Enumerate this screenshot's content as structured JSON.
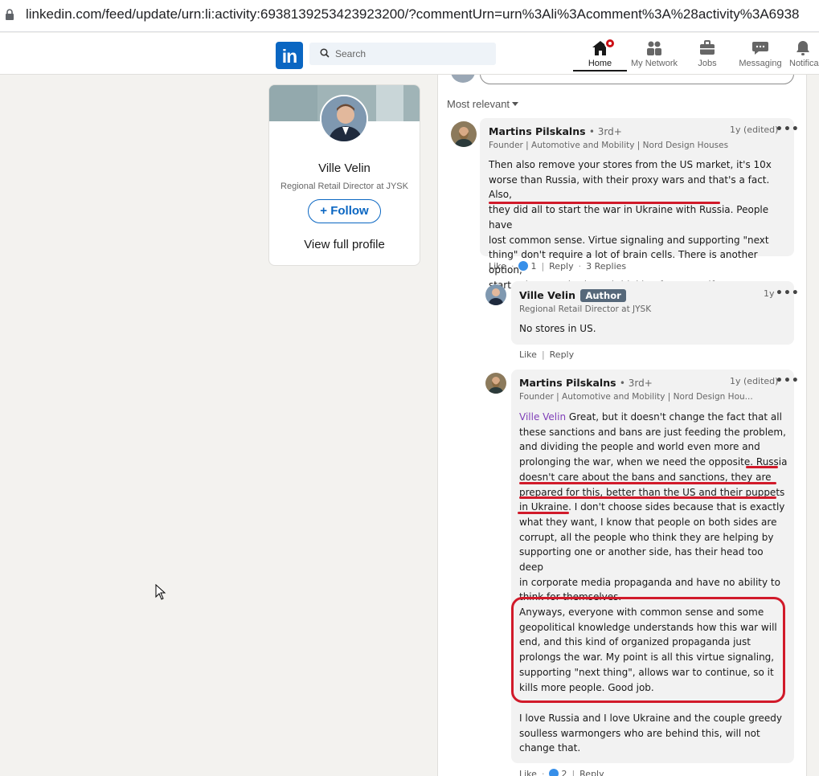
{
  "browser": {
    "url": "linkedin.com/feed/update/urn:li:activity:6938139253423923200/?commentUrn=urn%3Ali%3Acomment%3A%28activity%3A6938"
  },
  "nav": {
    "logo": "in",
    "search_placeholder": "Search",
    "items": [
      {
        "label": "Home",
        "icon": "home-icon"
      },
      {
        "label": "My Network",
        "icon": "network-icon"
      },
      {
        "label": "Jobs",
        "icon": "briefcase-icon"
      },
      {
        "label": "Messaging",
        "icon": "chat-icon"
      },
      {
        "label": "Notifica",
        "icon": "bell-icon"
      }
    ]
  },
  "profile": {
    "name": "Ville Velin",
    "headline": "Regional Retail Director at JYSK",
    "follow_label": "+ Follow",
    "view_profile": "View full profile"
  },
  "comments": {
    "sort_label": "Most relevant",
    "c1": {
      "name": "Martins Pilskalns",
      "degree": "• 3rd+",
      "headline": "Founder | Automotive and Mobility | Nord Design Houses",
      "time": "1y (edited)",
      "more": "•••",
      "lines": [
        "Then also remove your stores from the US market, it's 10x",
        "worse than Russia, with their proxy wars and that's a fact. Also,",
        "they did all to start the war in Ukraine with Russia. People have",
        "lost common sense. Virtue signaling and supporting \"next",
        "thing\" don't require a lot of brain cells. There is another option,",
        "start using your brain and thinking for yourself."
      ],
      "like": "Like",
      "reaction_count": "1",
      "reply": "Reply",
      "replies": "3 Replies"
    },
    "r1": {
      "name": "Ville Velin",
      "badge": "Author",
      "headline": "Regional Retail Director at JYSK",
      "time": "1y",
      "more": "•••",
      "text": "No stores in US.",
      "like": "Like",
      "reply": "Reply"
    },
    "r2": {
      "name": "Martins Pilskalns",
      "degree": "• 3rd+",
      "headline": "Founder | Automotive and Mobility | Nord Design Hou...",
      "time": "1y (edited)",
      "more": "•••",
      "mention": "Ville Velin",
      "lines": [
        " Great, but it doesn't change the fact that all",
        "these sanctions and bans are just feeding the problem,",
        "and dividing the people and world even more and",
        "prolonging the war, when we need the opposite. Russia",
        "doesn't care about the bans and sanctions, they are",
        "prepared for this, better than the US and their puppets",
        "in Ukraine. I don't choose sides because that is exactly",
        "what they want, I know that people on both sides are",
        "corrupt, all the people who think they are helping by",
        "supporting one or another side, has their head too deep",
        "in corporate media propaganda and have no ability to",
        "think for themselves."
      ],
      "para2": [
        "Anyways, everyone with common sense and some",
        "geopolitical knowledge understands how this war will",
        "end, and this kind of organized propaganda just",
        "prolongs the war. My point is all this virtue signaling,",
        "supporting \"next thing\", allows war to continue, so it",
        "kills more people. Good job."
      ],
      "para3": [
        "I love Russia and I love Ukraine and the couple greedy",
        "soulless warmongers who are behind this, will not",
        "change that."
      ],
      "like": "Like",
      "reaction_count": "2",
      "reply": "Reply"
    }
  },
  "colors": {
    "linkedin_blue": "#0a66c2",
    "annotation_red": "#d11a2a",
    "mention_purple": "#7e3eb8"
  }
}
